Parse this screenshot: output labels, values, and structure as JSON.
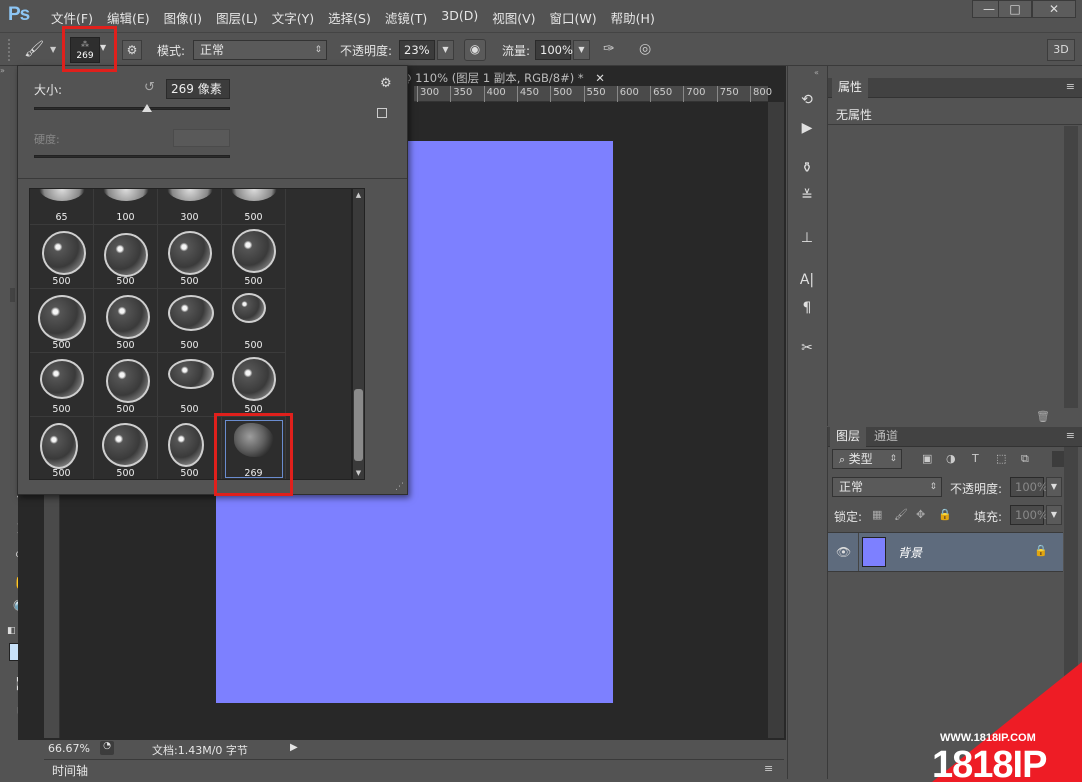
{
  "app": {
    "logo": "Ps",
    "menu": [
      "文件(F)",
      "编辑(E)",
      "图像(I)",
      "图层(L)",
      "文字(Y)",
      "选择(S)",
      "滤镜(T)",
      "3D(D)",
      "视图(V)",
      "窗口(W)",
      "帮助(H)"
    ],
    "window_buttons": [
      "—",
      "□",
      "✕"
    ]
  },
  "options": {
    "brush_size": "269",
    "mode_label": "模式:",
    "mode_value": "正常",
    "opacity_label": "不透明度:",
    "opacity_value": "23%",
    "flow_label": "流量:",
    "flow_value": "100%",
    "btn_3d": "3D"
  },
  "document": {
    "tab_title": "@ 110% (图层 1 副本, RGB/8#) *",
    "ruler_ticks": [
      "300",
      "350",
      "400",
      "450",
      "500",
      "550",
      "600",
      "650",
      "700",
      "750",
      "800"
    ],
    "canvas_color": "#7d80ff",
    "zoom": "66.67%",
    "doc_info": "文档:1.43M/0 字节",
    "timeline": "时间轴"
  },
  "brush_popup": {
    "size_label": "大小:",
    "size_value": "269 像素",
    "size_level": 0.57,
    "hardness_label": "硬度:",
    "top_row": [
      "65",
      "100",
      "300",
      "500"
    ],
    "rows": [
      [
        "500",
        "500",
        "500",
        "500"
      ],
      [
        "500",
        "500",
        "500",
        "500"
      ],
      [
        "500",
        "500",
        "500",
        "500"
      ],
      [
        "500",
        "500",
        "500",
        "269"
      ]
    ]
  },
  "properties": {
    "tab": "属性",
    "body": "无属性"
  },
  "layers": {
    "tab_active": "图层",
    "tab_other": "通道",
    "filter_label": "类型",
    "blend_mode": "正常",
    "opacity_label": "不透明度:",
    "opacity_value": "100%",
    "lock_label": "锁定:",
    "fill_label": "填充:",
    "fill_value": "100%",
    "layer_name": "背景"
  },
  "watermark": {
    "url": "WWW.1818IP.COM",
    "logo": "1818IP"
  }
}
